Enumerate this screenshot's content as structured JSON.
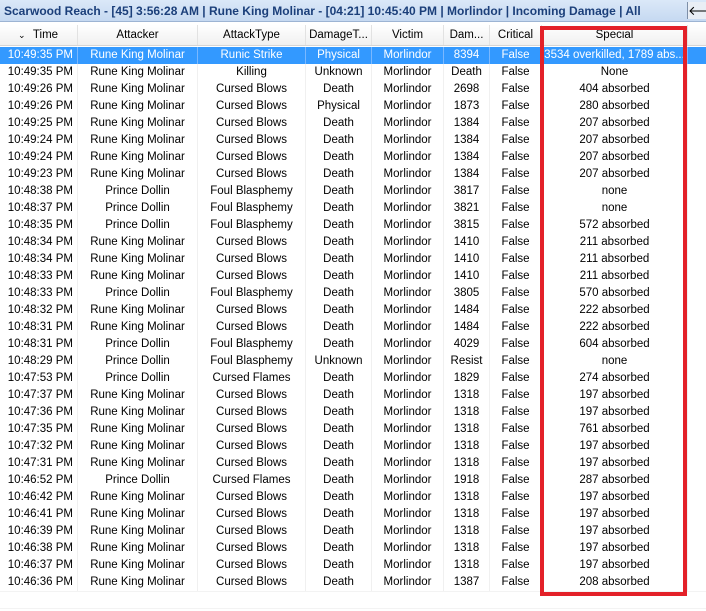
{
  "titlebar": {
    "text": "Scarwood Reach - [45] 3:56:28 AM  |  Rune King Molinar - [04:21] 10:45:40 PM  |  Morlindor  |  Incoming Damage  |  All",
    "back_icon": "arrow-left-icon",
    "back_glyph": "🡐"
  },
  "grid": {
    "sort_glyph": "⌄",
    "columns": [
      "Time",
      "Attacker",
      "AttackType",
      "DamageT...",
      "Victim",
      "Dam...",
      "Critical",
      "Special"
    ],
    "selected_row": 0,
    "rows": [
      [
        "10:49:35 PM",
        "Rune King Molinar",
        "Runic Strike",
        "Physical",
        "Morlindor",
        "8394",
        "False",
        "3534 overkilled, 1789 abs..."
      ],
      [
        "10:49:35 PM",
        "Rune King Molinar",
        "Killing",
        "Unknown",
        "Morlindor",
        "Death",
        "False",
        "None"
      ],
      [
        "10:49:26 PM",
        "Rune King Molinar",
        "Cursed Blows",
        "Death",
        "Morlindor",
        "2698",
        "False",
        "404 absorbed"
      ],
      [
        "10:49:26 PM",
        "Rune King Molinar",
        "Cursed Blows",
        "Physical",
        "Morlindor",
        "1873",
        "False",
        "280 absorbed"
      ],
      [
        "10:49:25 PM",
        "Rune King Molinar",
        "Cursed Blows",
        "Death",
        "Morlindor",
        "1384",
        "False",
        "207 absorbed"
      ],
      [
        "10:49:24 PM",
        "Rune King Molinar",
        "Cursed Blows",
        "Death",
        "Morlindor",
        "1384",
        "False",
        "207 absorbed"
      ],
      [
        "10:49:24 PM",
        "Rune King Molinar",
        "Cursed Blows",
        "Death",
        "Morlindor",
        "1384",
        "False",
        "207 absorbed"
      ],
      [
        "10:49:23 PM",
        "Rune King Molinar",
        "Cursed Blows",
        "Death",
        "Morlindor",
        "1384",
        "False",
        "207 absorbed"
      ],
      [
        "10:48:38 PM",
        "Prince Dollin",
        "Foul Blasphemy",
        "Death",
        "Morlindor",
        "3817",
        "False",
        "none"
      ],
      [
        "10:48:37 PM",
        "Prince Dollin",
        "Foul Blasphemy",
        "Death",
        "Morlindor",
        "3821",
        "False",
        "none"
      ],
      [
        "10:48:35 PM",
        "Prince Dollin",
        "Foul Blasphemy",
        "Death",
        "Morlindor",
        "3815",
        "False",
        "572 absorbed"
      ],
      [
        "10:48:34 PM",
        "Rune King Molinar",
        "Cursed Blows",
        "Death",
        "Morlindor",
        "1410",
        "False",
        "211 absorbed"
      ],
      [
        "10:48:34 PM",
        "Rune King Molinar",
        "Cursed Blows",
        "Death",
        "Morlindor",
        "1410",
        "False",
        "211 absorbed"
      ],
      [
        "10:48:33 PM",
        "Rune King Molinar",
        "Cursed Blows",
        "Death",
        "Morlindor",
        "1410",
        "False",
        "211 absorbed"
      ],
      [
        "10:48:33 PM",
        "Prince Dollin",
        "Foul Blasphemy",
        "Death",
        "Morlindor",
        "3805",
        "False",
        "570 absorbed"
      ],
      [
        "10:48:32 PM",
        "Rune King Molinar",
        "Cursed Blows",
        "Death",
        "Morlindor",
        "1484",
        "False",
        "222 absorbed"
      ],
      [
        "10:48:31 PM",
        "Rune King Molinar",
        "Cursed Blows",
        "Death",
        "Morlindor",
        "1484",
        "False",
        "222 absorbed"
      ],
      [
        "10:48:31 PM",
        "Prince Dollin",
        "Foul Blasphemy",
        "Death",
        "Morlindor",
        "4029",
        "False",
        "604 absorbed"
      ],
      [
        "10:48:29 PM",
        "Prince Dollin",
        "Foul Blasphemy",
        "Unknown",
        "Morlindor",
        "Resist",
        "False",
        "none"
      ],
      [
        "10:47:53 PM",
        "Prince Dollin",
        "Cursed Flames",
        "Death",
        "Morlindor",
        "1829",
        "False",
        "274 absorbed"
      ],
      [
        "10:47:37 PM",
        "Rune King Molinar",
        "Cursed Blows",
        "Death",
        "Morlindor",
        "1318",
        "False",
        "197 absorbed"
      ],
      [
        "10:47:36 PM",
        "Rune King Molinar",
        "Cursed Blows",
        "Death",
        "Morlindor",
        "1318",
        "False",
        "197 absorbed"
      ],
      [
        "10:47:35 PM",
        "Rune King Molinar",
        "Cursed Blows",
        "Death",
        "Morlindor",
        "1318",
        "False",
        "761 absorbed"
      ],
      [
        "10:47:32 PM",
        "Rune King Molinar",
        "Cursed Blows",
        "Death",
        "Morlindor",
        "1318",
        "False",
        "197 absorbed"
      ],
      [
        "10:47:31 PM",
        "Rune King Molinar",
        "Cursed Blows",
        "Death",
        "Morlindor",
        "1318",
        "False",
        "197 absorbed"
      ],
      [
        "10:46:52 PM",
        "Prince Dollin",
        "Cursed Flames",
        "Death",
        "Morlindor",
        "1918",
        "False",
        "287 absorbed"
      ],
      [
        "10:46:42 PM",
        "Rune King Molinar",
        "Cursed Blows",
        "Death",
        "Morlindor",
        "1318",
        "False",
        "197 absorbed"
      ],
      [
        "10:46:41 PM",
        "Rune King Molinar",
        "Cursed Blows",
        "Death",
        "Morlindor",
        "1318",
        "False",
        "197 absorbed"
      ],
      [
        "10:46:39 PM",
        "Rune King Molinar",
        "Cursed Blows",
        "Death",
        "Morlindor",
        "1318",
        "False",
        "197 absorbed"
      ],
      [
        "10:46:38 PM",
        "Rune King Molinar",
        "Cursed Blows",
        "Death",
        "Morlindor",
        "1318",
        "False",
        "197 absorbed"
      ],
      [
        "10:46:37 PM",
        "Rune King Molinar",
        "Cursed Blows",
        "Death",
        "Morlindor",
        "1318",
        "False",
        "197 absorbed"
      ],
      [
        "10:46:36 PM",
        "Rune King Molinar",
        "Cursed Blows",
        "Death",
        "Morlindor",
        "1387",
        "False",
        "208 absorbed"
      ]
    ]
  },
  "annotation": {
    "highlight_color": "#e32129",
    "highlight_target": "Special column"
  },
  "colors": {
    "selected_row": "#3399ff",
    "title_text": "#1b3f7a"
  }
}
